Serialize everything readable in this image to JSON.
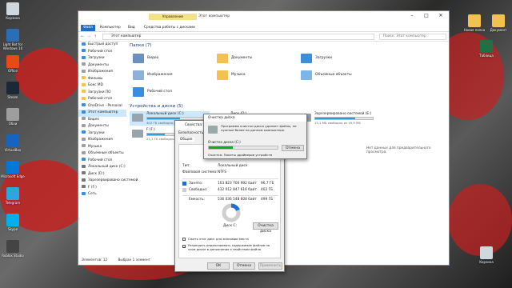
{
  "desktop": {
    "icons_left": [
      {
        "label": "Корзина",
        "color": "#cfd8dc"
      },
      {
        "label": "Light Bot for Windows 10",
        "color": "#2a6fb5"
      },
      {
        "label": "Office",
        "color": "#e64a19"
      },
      {
        "label": "Steam",
        "color": "#1b2838"
      },
      {
        "label": "Обои",
        "color": "#9e9e9e"
      },
      {
        "label": "VirtualBox",
        "color": "#1565c0"
      },
      {
        "label": "Microsoft Edge",
        "color": "#0078d7"
      },
      {
        "label": "Telegram",
        "color": "#2ca5e0"
      },
      {
        "label": "Skype",
        "color": "#00aff0"
      },
      {
        "label": "Roblox Studio",
        "color": "#444"
      }
    ],
    "icons_right": [
      {
        "label": "Новая папка",
        "color": "#f2c14e"
      },
      {
        "label": "Документ",
        "color": "#f2c14e"
      },
      {
        "label": "Таблица",
        "color": "#1e7145"
      },
      {
        "label": "Корзина",
        "color": "#cfd8dc"
      }
    ]
  },
  "window": {
    "tab_manage": "Управление",
    "title": "Этот компьютер",
    "ribbon": [
      "Файл",
      "Компьютер",
      "Вид",
      "Средства работы с дисками"
    ],
    "address": "Этот компьютер",
    "search_placeholder": "Поиск: Этот компьютер",
    "sidebar": [
      {
        "label": "Быстрый доступ",
        "color": "#3b8ddd"
      },
      {
        "label": "Рабочий стол",
        "color": "#3b8ddd"
      },
      {
        "label": "Загрузки",
        "color": "#3b8ddd"
      },
      {
        "label": "Документы",
        "color": "#9e9e9e"
      },
      {
        "label": "Изображения",
        "color": "#9e9e9e"
      },
      {
        "label": "Фильмы",
        "color": "#f2c14e"
      },
      {
        "label": "Бокс MD",
        "color": "#f2c14e"
      },
      {
        "label": "Загрузки ПО",
        "color": "#f2c14e"
      },
      {
        "label": "Рабочий стол",
        "color": "#f2c14e"
      },
      {
        "label": "OneDrive - Personal",
        "color": "#3b8ddd"
      },
      {
        "label": "Этот компьютер",
        "color": "#3b8ddd"
      },
      {
        "label": "Видео",
        "color": "#9e9e9e"
      },
      {
        "label": "Документы",
        "color": "#9e9e9e"
      },
      {
        "label": "Загрузки",
        "color": "#3b8ddd"
      },
      {
        "label": "Изображения",
        "color": "#9e9e9e"
      },
      {
        "label": "Музыка",
        "color": "#9e9e9e"
      },
      {
        "label": "Объемные объекты",
        "color": "#9e9e9e"
      },
      {
        "label": "Рабочий стол",
        "color": "#3b8ddd"
      },
      {
        "label": "Локальный диск (C:)",
        "color": "#777"
      },
      {
        "label": "Диск (D:)",
        "color": "#777"
      },
      {
        "label": "Зарезервировано системой",
        "color": "#777"
      },
      {
        "label": "F (F:)",
        "color": "#777"
      },
      {
        "label": "Сеть",
        "color": "#3b8ddd"
      }
    ],
    "folders_header": "Папки (7)",
    "folders": [
      "Видео",
      "Документы",
      "Загрузки",
      "Изображения",
      "Музыка",
      "Объемные объекты",
      "Рабочий стол"
    ],
    "drives_header": "Устройства и диски (5)",
    "drives": [
      {
        "name": "Локальный диск (C:)",
        "free": "402 ГБ свободно из 936 ГБ",
        "fill": 0.57
      },
      {
        "name": "Диск (D:)",
        "free": "",
        "fill": 0.2
      },
      {
        "name": "Зарезервировано системой (E:)",
        "free": "15,1 МБ свободно из 49,9 МБ",
        "fill": 0.7
      },
      {
        "name": "F (F:)",
        "free": "21,1 ГБ свободно из ...",
        "fill": 0.3
      }
    ],
    "preview_text": "Нет данных для предварительного просмотра.",
    "status_items": "Элементов: 12",
    "status_selected": "Выбран 1 элемент"
  },
  "properties": {
    "title": "Свойства: Локальный диск (C:)",
    "tabs": [
      "Безопасность",
      "Общие"
    ],
    "type_label": "Тип:",
    "type_value": "Локальный диск",
    "fs_label": "Файловая система:",
    "fs_value": "NTFS",
    "used_label": "Занято:",
    "used_bytes": "103 823 700 992 байт",
    "used_gb": "96,7 ГБ",
    "free_label": "Свободно:",
    "free_bytes": "432 012 847 616 байт",
    "free_gb": "402 ГБ",
    "cap_label": "Емкость:",
    "cap_bytes": "536 036 548 608 байт",
    "cap_gb": "499 ГБ",
    "used_fraction": 0.19,
    "disk_label": "Диск C:",
    "cleanup_button": "Очистка диска",
    "compress_label": "Сжать этот диск для экономии места",
    "index_label": "Разрешить индексировать содержимое файлов на этом диске в дополнение к свойствам файла",
    "ok": "ОК",
    "cancel": "Отмена",
    "apply": "Применить"
  },
  "cleanup": {
    "title": "Очистка диска",
    "message": "Программа очистки диска удаляет файлы, не нужные более на данном компьютере.",
    "label": "Очистка диска (C:)",
    "progress": 0.35,
    "cancel": "Отмена",
    "status": "Очистка: Пакеты драйверов устройств"
  }
}
